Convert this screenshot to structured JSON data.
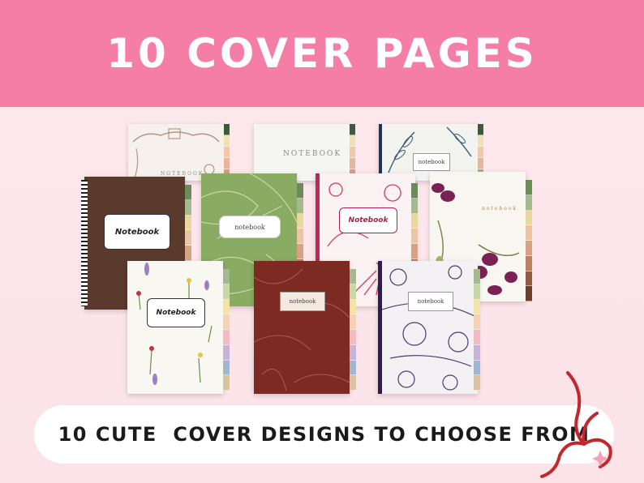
{
  "header": {
    "title": "10 COVER PAGES"
  },
  "covers": {
    "notebook_serif": "NOTEBOOK",
    "notebook_script": "Notebook",
    "notebook_lower": "notebook"
  },
  "footer": {
    "tagline": "10 CUTE  COVER DESIGNS TO CHOOSE FROM"
  },
  "colors": {
    "header_bg": "#f57ea6",
    "page_bg": "#fde9ee",
    "ribbon": "#c1272d"
  }
}
